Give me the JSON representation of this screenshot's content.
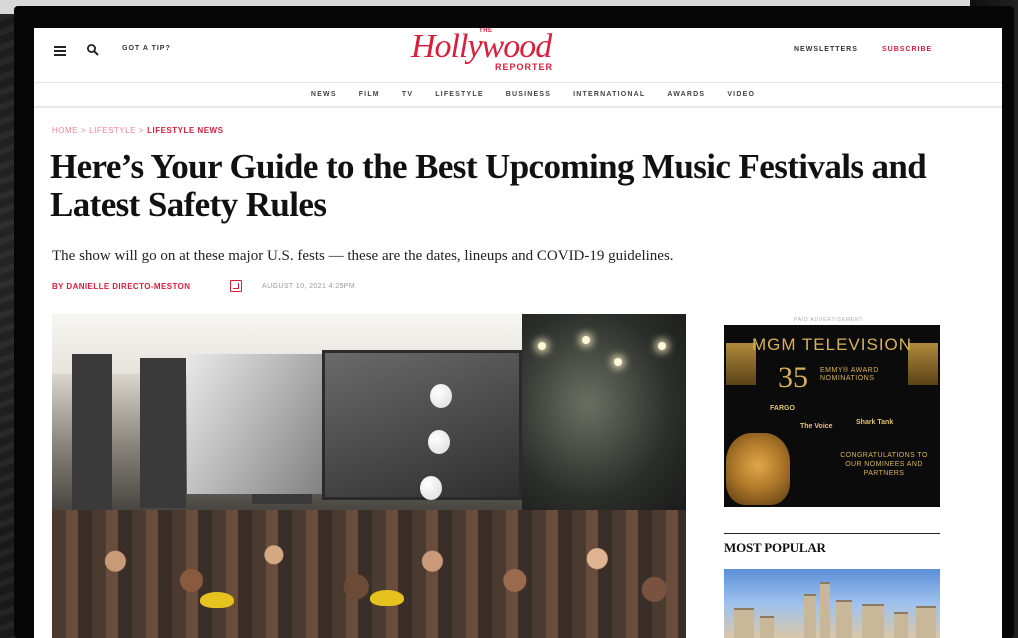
{
  "header": {
    "tip_label": "GOT A TIP?",
    "logo_the": "THE",
    "logo_main": "Hollywood",
    "logo_reporter": "REPORTER",
    "newsletters_label": "NEWSLETTERS",
    "subscribe_label": "SUBSCRIBE",
    "brand_color": "#d81f3c",
    "icons": [
      "menu-icon",
      "search-icon"
    ]
  },
  "nav": {
    "items": [
      {
        "label": "NEWS"
      },
      {
        "label": "FILM"
      },
      {
        "label": "TV"
      },
      {
        "label": "LIFESTYLE"
      },
      {
        "label": "BUSINESS"
      },
      {
        "label": "INTERNATIONAL"
      },
      {
        "label": "AWARDS"
      },
      {
        "label": "VIDEO"
      }
    ]
  },
  "breadcrumb": {
    "items": [
      "HOME",
      "LIFESTYLE",
      "LIFESTYLE NEWS"
    ],
    "separator": ">"
  },
  "article": {
    "headline": "Here’s Your Guide to the Best Upcoming Music Festivals and Latest Safety Rules",
    "dek": "The show will go on at these major U.S. fests — these are the dates, lineups and COVID-19 guidelines.",
    "byline": "BY DANIELLE DIRECTO-MESTON",
    "dateline": "AUGUST 10, 2021 4:25PM"
  },
  "sidebar": {
    "ad_label": "PAID ADVERTISEMENT",
    "ad": {
      "title": "MGM TELEVISION",
      "emmy_count": "35",
      "emmy_text": "EMMY® AWARD NOMINATIONS",
      "show_logos": [
        "FARGO",
        "The Voice",
        "Shark Tank"
      ],
      "congrats": "CONGRATULATIONS TO OUR NOMINEES AND PARTNERS"
    },
    "most_popular_title": "MOST POPULAR"
  }
}
